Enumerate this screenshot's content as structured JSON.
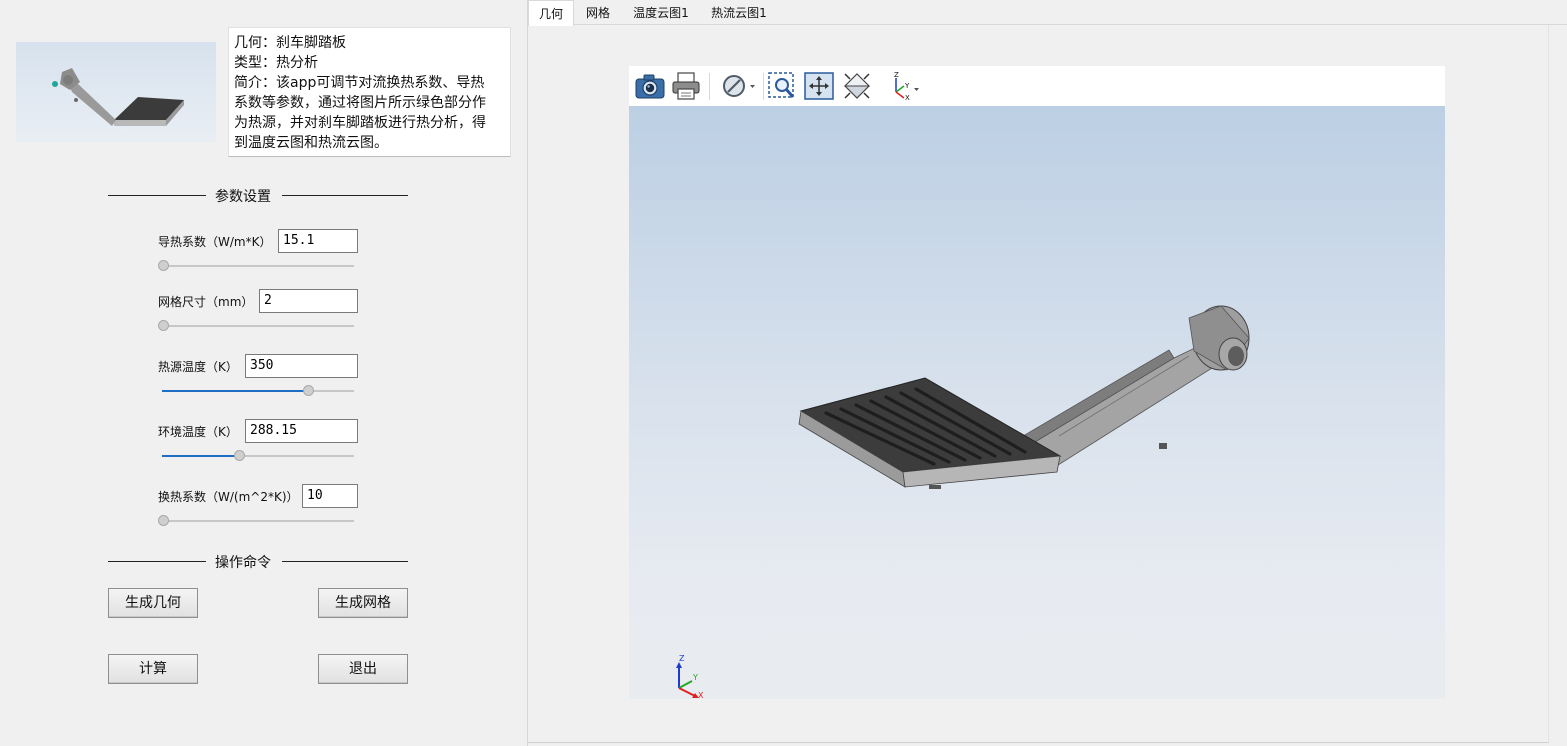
{
  "description": {
    "lines": [
      "几何：刹车脚踏板",
      "类型：热分析",
      "简介：该app可调节对流换热系数、导热",
      "系数等参数，通过将图片所示绿色部分作",
      "为热源，并对刹车脚踏板进行热分析，得",
      "到温度云图和热流云图。"
    ]
  },
  "sections": {
    "params_title": "参数设置",
    "commands_title": "操作命令"
  },
  "params": [
    {
      "label": "导热系数（W/m*K）",
      "value": "15.1",
      "slider_fraction": 0.0
    },
    {
      "label": "网格尺寸（mm）",
      "value": "2",
      "slider_fraction": 0.0
    },
    {
      "label": "热源温度（K）",
      "value": "350",
      "slider_fraction": 0.76
    },
    {
      "label": "环境温度（K）",
      "value": "288.15",
      "slider_fraction": 0.4
    },
    {
      "label": "换热系数（W/(m^2*K)）",
      "value": "10",
      "slider_fraction": 0.0
    }
  ],
  "buttons": {
    "gen_geometry": "生成几何",
    "gen_mesh": "生成网格",
    "compute": "计算",
    "exit": "退出"
  },
  "tabs": [
    {
      "label": "几何",
      "active": true
    },
    {
      "label": "网格",
      "active": false
    },
    {
      "label": "温度云图1",
      "active": false
    },
    {
      "label": "热流云图1",
      "active": false
    }
  ],
  "toolbar": {
    "icons": [
      "camera-icon",
      "print-icon",
      "visibility-icon",
      "zoom-box-icon",
      "zoom-fit-icon",
      "view-iso-icon",
      "axis-orient-icon"
    ],
    "axis_labels": {
      "z": "Z",
      "y": "Y",
      "x": "X"
    }
  },
  "colors": {
    "slider_fill": "#1e6fc3",
    "axis_x": "#e02020",
    "axis_y": "#22aa22",
    "axis_z": "#1c3ccf",
    "model": "#8a8a8a"
  }
}
